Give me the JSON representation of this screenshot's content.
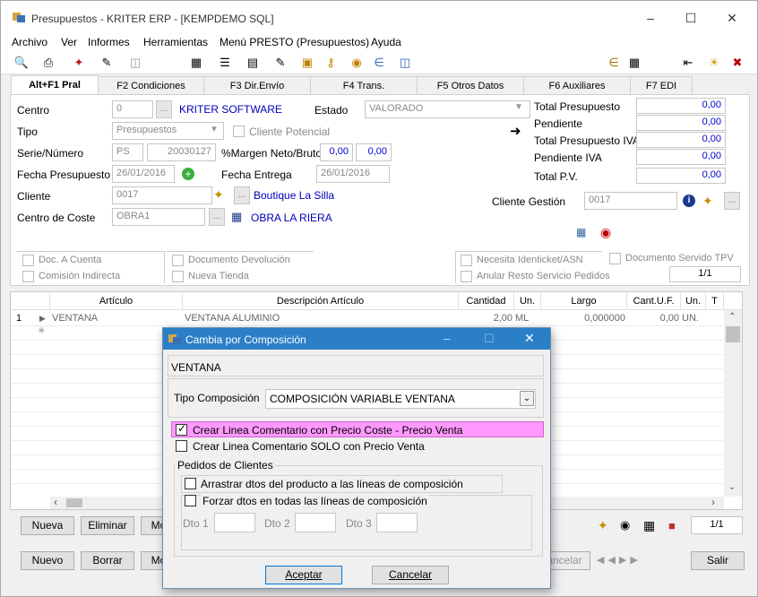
{
  "window": {
    "title": "Presupuestos - KRITER ERP - [KEMPDEMO SQL]"
  },
  "menu": [
    "Archivo",
    "Ver",
    "Informes",
    "Herramientas",
    "Menú PRESTO (Presupuestos)",
    "Ayuda"
  ],
  "tabs": [
    "Alt+F1 Pral",
    "F2 Condiciones",
    "F3 Dir.Envío",
    "F4 Trans.",
    "F5 Otros Datos",
    "F6 Auxiliares",
    "F7 EDI"
  ],
  "form": {
    "centro_label": "Centro",
    "centro_value": "0",
    "centro_name": "KRITER SOFTWARE",
    "estado_label": "Estado",
    "estado_value": "VALORADO",
    "tipo_label": "Tipo",
    "tipo_value": "Presupuestos",
    "cliente_potencial": "Cliente Potencial",
    "serie_label": "Serie/Número",
    "serie_value": "PS",
    "numero_value": "20030127",
    "margen_label": "%Margen Neto/Bruto",
    "margen_neto": "0,00",
    "margen_bruto": "0,00",
    "fecha_pres_label": "Fecha Presupuesto",
    "fecha_pres_value": "26/01/2016",
    "fecha_ent_label": "Fecha Entrega",
    "fecha_ent_value": "26/01/2016",
    "cliente_label": "Cliente",
    "cliente_value": "0017",
    "cliente_name": "Boutique La Silla",
    "coste_label": "Centro de Coste",
    "coste_value": "OBRA1",
    "coste_name": "OBRA LA RIERA",
    "cliente_gestion_label": "Cliente Gestión",
    "cliente_gestion_value": "0017"
  },
  "totals": [
    {
      "label": "Total Presupuesto",
      "value": "0,00"
    },
    {
      "label": "Pendiente",
      "value": "0,00"
    },
    {
      "label": "Total Presupuesto IVA",
      "value": "0,00"
    },
    {
      "label": "Pendiente IVA",
      "value": "0,00"
    },
    {
      "label": "Total P.V.",
      "value": "0,00"
    }
  ],
  "checks": {
    "doc_cuenta": "Doc. A Cuenta",
    "comision": "Comisión Indirecta",
    "doc_devolucion": "Documento Devolución",
    "nueva_tienda": "Nueva Tienda",
    "identicket": "Necesita Identicket/ASN",
    "anular": "Anular Resto Servicio Pedidos",
    "servido_tpv": "Documento Servido TPV",
    "pager": "1/1"
  },
  "grid": {
    "headers": [
      "Artículo",
      "Descripción Artículo",
      "Cantidad",
      "Un.",
      "Largo",
      "Cant.U.F.",
      "Un.",
      "T"
    ],
    "row": {
      "num": "1",
      "articulo": "VENTANA",
      "descripcion": "VENTANA ALUMINIO",
      "cantidad": "2,00",
      "un": "ML",
      "largo": "0,000000",
      "cantuf": "0,00",
      "un2": "UN."
    }
  },
  "grid_buttons": {
    "nueva": "Nueva",
    "eliminar": "Eliminar",
    "mo": "Mo",
    "pager": "1/1"
  },
  "bottom_buttons": {
    "nuevo": "Nuevo",
    "borrar": "Borrar",
    "mo": "Mo",
    "cancelar": "ancelar",
    "salir": "Salir"
  },
  "dialog": {
    "title": "Cambia por Composición",
    "header": "VENTANA",
    "tipo_label": "Tipo Composición",
    "tipo_value": "COMPOSICIÓN VARIABLE VENTANA",
    "opt1": "Crear Linea Comentario con Precio Coste - Precio Venta",
    "opt2": "Crear Linea Comentario SOLO con Precio Venta",
    "group": "Pedidos de Clientes",
    "arrastrar": "Arrastrar dtos del producto a las líneas de composición",
    "forzar": "Forzar dtos en todas las líneas de composición",
    "dto1": "Dto 1",
    "dto2": "Dto 2",
    "dto3": "Dto 3",
    "aceptar": "Aceptar",
    "cancelar": "Cancelar"
  },
  "colors": {
    "accent": "#2b7fc7",
    "highlight": "#ff99ff",
    "link": "#0000bb"
  }
}
